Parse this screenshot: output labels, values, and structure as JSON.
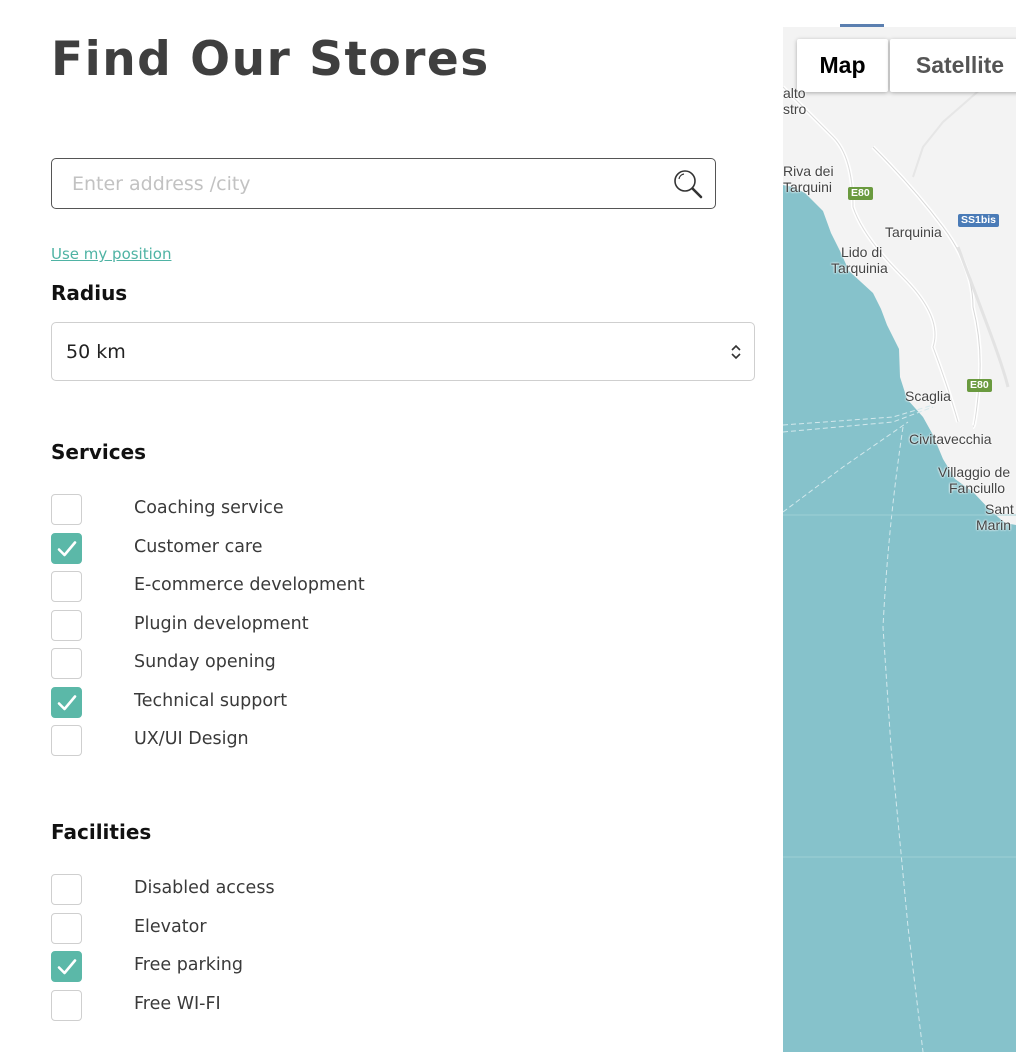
{
  "page": {
    "title": "Find Our Stores"
  },
  "search": {
    "placeholder": "Enter address /city",
    "use_position_label": "Use my position"
  },
  "radius": {
    "heading": "Radius",
    "selected": "50 km"
  },
  "services": {
    "heading": "Services",
    "items": [
      {
        "label": "Coaching service",
        "checked": false
      },
      {
        "label": "Customer care",
        "checked": true
      },
      {
        "label": "E-commerce development",
        "checked": false
      },
      {
        "label": "Plugin development",
        "checked": false
      },
      {
        "label": "Sunday opening",
        "checked": false
      },
      {
        "label": "Technical support",
        "checked": true
      },
      {
        "label": "UX/UI Design",
        "checked": false
      }
    ]
  },
  "facilities": {
    "heading": "Facilities",
    "items": [
      {
        "label": "Disabled access",
        "checked": false
      },
      {
        "label": "Elevator",
        "checked": false
      },
      {
        "label": "Free parking",
        "checked": true
      },
      {
        "label": "Free WI-FI",
        "checked": false
      }
    ]
  },
  "map": {
    "type_buttons": {
      "map": "Map",
      "satellite": "Satellite"
    },
    "labels": {
      "alto": "alto",
      "stro": "stro",
      "riva1": "Riva dei",
      "riva2": "Tarquini",
      "tarquinia": "Tarquinia",
      "lido1": "Lido di",
      "lido2": "Tarquinia",
      "scaglia": "Scaglia",
      "civitavecchia": "Civitavecchia",
      "villaggio1": "Villaggio de",
      "villaggio2": "Fanciullo",
      "santa1": "Sant",
      "santa2": "Marin"
    },
    "shields": {
      "e80_a": "E80",
      "e80_b": "E80",
      "ss1bis": "SS1bis"
    }
  },
  "colors": {
    "accent": "#5bb8a8",
    "link": "#4fb3a4",
    "sea": "#86c2cb",
    "land": "#f3f3f3"
  }
}
